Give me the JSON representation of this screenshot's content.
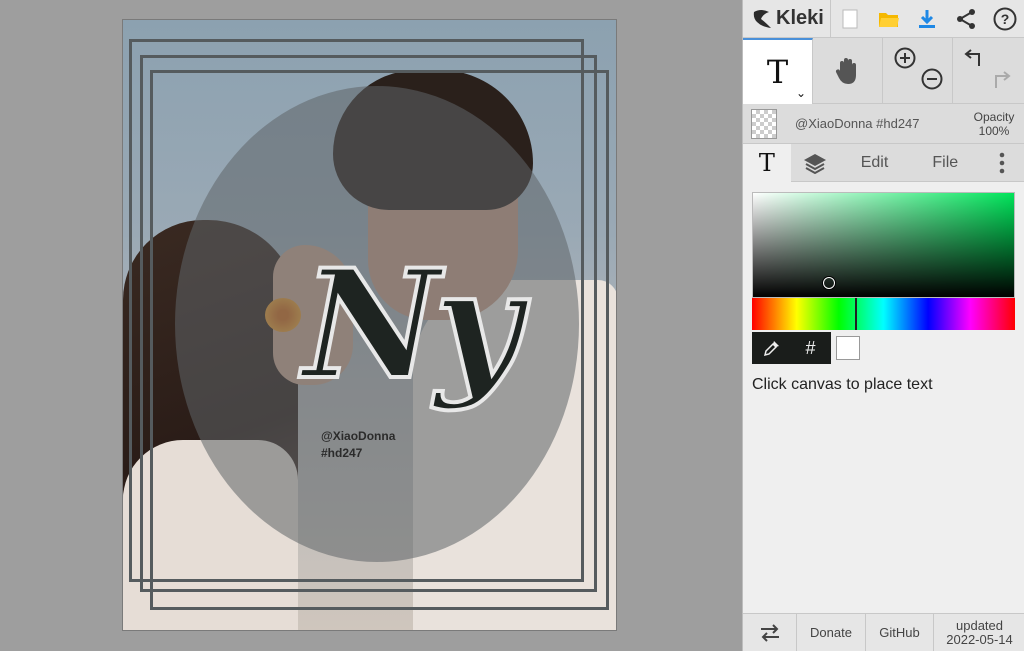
{
  "app": {
    "name": "Kleki"
  },
  "canvas": {
    "big_text": "Ny",
    "watermark_line1": "@XiaoDonna",
    "watermark_line2": "#hd247"
  },
  "layer": {
    "name": "@XiaoDonna #hd247",
    "opacity_label": "Opacity",
    "opacity_value": "100%"
  },
  "tabs": {
    "edit": "Edit",
    "file": "File"
  },
  "tool_settings": {
    "hue_marker_fraction": 0.39,
    "selected_color": "#ffffff",
    "hash_label": "#",
    "hint": "Click canvas to place text"
  },
  "bottom": {
    "donate": "Donate",
    "github": "GitHub",
    "updated_label": "updated",
    "updated_date": "2022-05-14"
  },
  "colors": {
    "accent": "#4a90d9",
    "download": "#1e88e5",
    "folder": "#f5b800"
  }
}
